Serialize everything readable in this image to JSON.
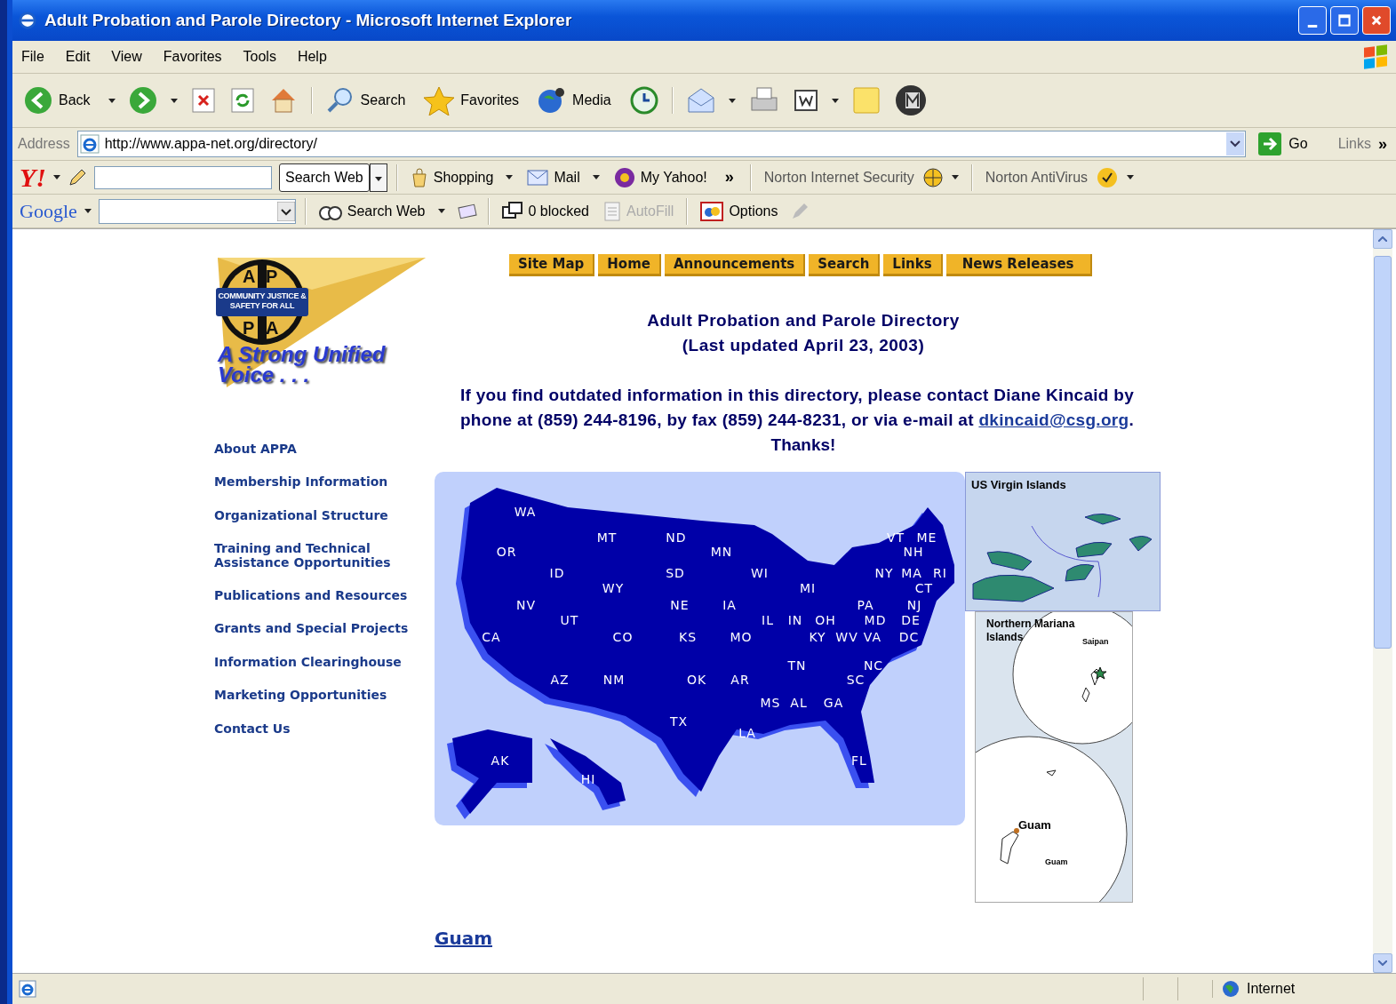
{
  "window": {
    "title": "Adult Probation and Parole Directory - Microsoft Internet Explorer"
  },
  "menu": [
    "File",
    "Edit",
    "View",
    "Favorites",
    "Tools",
    "Help"
  ],
  "toolbar": [
    {
      "kind": "back",
      "label": "Back"
    },
    {
      "kind": "forward"
    },
    {
      "kind": "stop"
    },
    {
      "kind": "refresh"
    },
    {
      "kind": "home"
    },
    {
      "kind": "search",
      "label": "Search"
    },
    {
      "kind": "favorites",
      "label": "Favorites"
    },
    {
      "kind": "media",
      "label": "Media"
    },
    {
      "kind": "history"
    },
    {
      "kind": "mail"
    },
    {
      "kind": "print"
    },
    {
      "kind": "edit"
    },
    {
      "kind": "note"
    },
    {
      "kind": "messenger"
    }
  ],
  "address": {
    "label": "Address",
    "value": "http://www.appa-net.org/directory/",
    "go": "Go",
    "links": "Links",
    "more": "»"
  },
  "yahoo_bar": {
    "logo": "Y!",
    "search_button": "Search Web",
    "items": [
      "Shopping",
      "Mail",
      "My Yahoo!"
    ],
    "more": "»",
    "norton_security": "Norton Internet Security",
    "norton_antivirus": "Norton AntiVirus"
  },
  "google_bar": {
    "logo": "Google",
    "search_button": "Search Web",
    "blocked": "0 blocked",
    "autofill": {
      "label": "AutoFill",
      "disabled": true
    },
    "options": "Options"
  },
  "nav": [
    "Site Map",
    "Home",
    "Announcements",
    "Search",
    "Links",
    "News Releases"
  ],
  "logo": {
    "letters": [
      "A",
      "P",
      "P",
      "A"
    ],
    "motto": "COMMUNITY JUSTICE & SAFETY FOR ALL",
    "tagline": "A Strong Unified Voice . . ."
  },
  "sidebar": [
    "About APPA",
    "Membership Information",
    "Organizational Structure",
    "Training and Technical Assistance Opportunities",
    "Publications and Resources",
    "Grants and Special Projects",
    "Information Clearinghouse",
    "Marketing Opportunities",
    "Contact Us"
  ],
  "heading": [
    "Adult Probation and Parole Directory",
    "(Last updated April 23, 2003)"
  ],
  "contact": {
    "before": "If you find outdated information in this directory, please contact Diane Kincaid by phone at (859) 244-8196, by fax (859) 244-8231, or via e-mail at ",
    "email": "dkincaid@csg.org",
    "after": ".",
    "thanks": "Thanks!"
  },
  "map": {
    "states": [
      "WA",
      "MT",
      "ND",
      "VT",
      "ME",
      "OR",
      "MN",
      "NH",
      "ID",
      "SD",
      "WI",
      "NY",
      "MA",
      "RI",
      "WY",
      "MI",
      "CT",
      "NV",
      "NE",
      "IA",
      "PA",
      "NJ",
      "UT",
      "IL",
      "IN",
      "OH",
      "MD",
      "DE",
      "CA",
      "CO",
      "KS",
      "MO",
      "KY",
      "WV",
      "VA",
      "DC",
      "TN",
      "NC",
      "AZ",
      "NM",
      "OK",
      "AR",
      "SC",
      "MS",
      "AL",
      "GA",
      "TX",
      "LA",
      "AK",
      "FL",
      "HI"
    ]
  },
  "insets": {
    "virgin_islands": "US Virgin Islands",
    "mariana_title": "Northern Mariana Islands",
    "saipan": "Saipan",
    "guam_label": "Guam",
    "guam_small": "Guam"
  },
  "links_below": [
    "Guam"
  ],
  "status_bar": {
    "zone": "Internet"
  }
}
